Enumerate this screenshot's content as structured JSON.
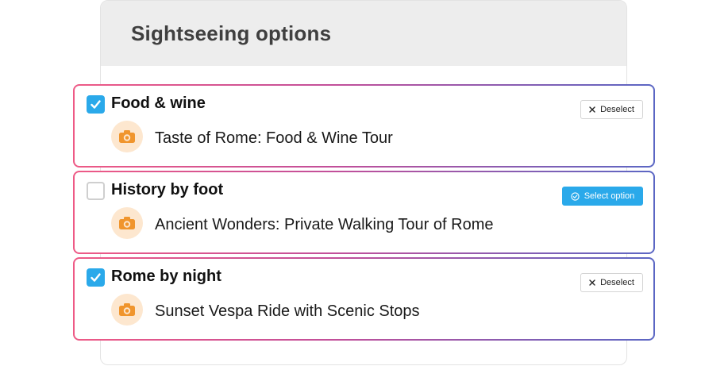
{
  "panel": {
    "title": "Sightseeing options"
  },
  "options": [
    {
      "category": "Food & wine",
      "tour": "Taste of Rome: Food & Wine Tour",
      "selected": true,
      "action_label": "Deselect"
    },
    {
      "category": "History by foot",
      "tour": "Ancient Wonders: Private Walking Tour of Rome",
      "selected": false,
      "action_label": "Select option"
    },
    {
      "category": "Rome by night",
      "tour": "Sunset Vespa Ride with Scenic Stops",
      "selected": true,
      "action_label": "Deselect"
    }
  ],
  "colors": {
    "accent_blue": "#2aa9ea",
    "camera_orange": "#f0952d",
    "camera_bg": "#fde7cf",
    "border_gradient_start": "#ee5a86",
    "border_gradient_end": "#5b67c4"
  },
  "icons": {
    "checkbox_checked": "check-icon",
    "tour": "camera-icon",
    "deselect": "close-icon",
    "select": "check-circle-icon"
  }
}
